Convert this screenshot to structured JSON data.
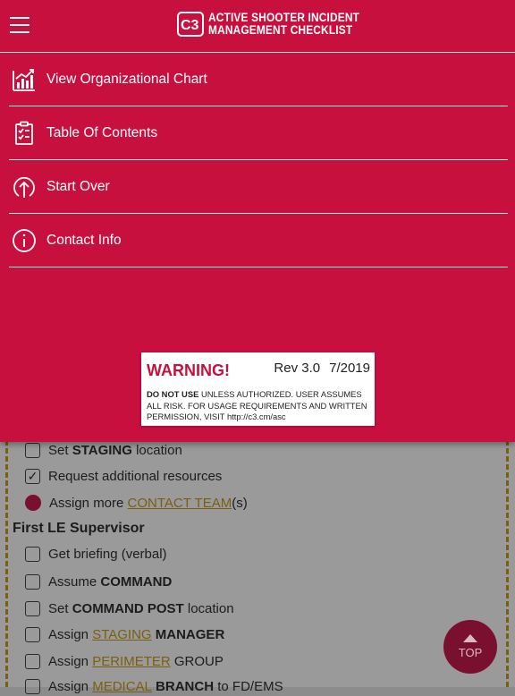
{
  "app": {
    "logo_mark": "C3",
    "title_line1": "ACTIVE SHOOTER INCIDENT",
    "title_line2": "MANAGEMENT CHECKLIST",
    "brand_color": "#c8103f"
  },
  "menu": {
    "items": [
      {
        "label": "View Organizational Chart",
        "icon": "org-chart-icon"
      },
      {
        "label": "Table Of Contents",
        "icon": "clipboard-checklist-icon"
      },
      {
        "label": "Start Over",
        "icon": "circle-up-arrow-icon"
      },
      {
        "label": "Contact Info",
        "icon": "info-icon"
      }
    ]
  },
  "warning": {
    "title": "WARNING!",
    "rev": "Rev 3.0",
    "date": "7/2019",
    "bold_lead": "DO NOT USE",
    "text": " UNLESS AUTHORIZED. USER ASSUMES ALL RISK. FOR USAGE REQUIREMENTS AND WRITTEN PERMISSION, VISIT http://c3.cm/asc"
  },
  "checklist": {
    "rows_top": [
      {
        "pre": "Set ",
        "bold": "STAGING",
        "post": " location",
        "state": "unchecked"
      },
      {
        "pre": "Request additional resources",
        "state": "checked"
      },
      {
        "pre": "Assign more ",
        "link": "CONTACT TEAM",
        "post": "(s)",
        "state": "dot"
      }
    ],
    "section": "First LE Supervisor",
    "rows": [
      {
        "pre": "Get briefing (verbal)"
      },
      {
        "pre": "Assume ",
        "bold": "COMMAND"
      },
      {
        "pre": "Set ",
        "bold": "COMMAND POST",
        "post": " location"
      },
      {
        "pre": "Assign ",
        "link": "STAGING",
        "bold": " MANAGER"
      },
      {
        "pre": "Assign ",
        "link": "PERIMETER",
        "post": " GROUP"
      },
      {
        "pre": "Assign ",
        "link": "MEDICAL",
        "bold": " BRANCH",
        "post": " to FD/EMS"
      }
    ],
    "check_mark": "✓"
  },
  "top_button": {
    "label": "TOP"
  }
}
